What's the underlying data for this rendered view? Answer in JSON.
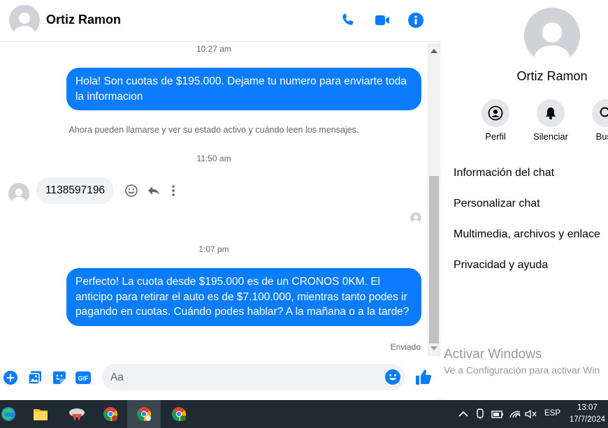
{
  "header": {
    "contact_name": "Ortiz Ramon"
  },
  "messages": {
    "ts1": "10:27 am",
    "out1": "Hola! Son cuotas de $195.000. Dejame tu numero para enviarte toda la informacion",
    "system_notice": "Ahora pueden llamarse y ver su estado activo y cuándo leen los mensajes.",
    "ts2": "11:50 am",
    "in1": "1138597196",
    "ts3": "1:07 pm",
    "out2": "Perfecto! La cuota desde $195.000 es de un CRONOS 0KM. El anticipo para retirar el auto es de $7.100.000, mientras tanto podes ir pagando en cuotas. Cuándo podes hablar? A la mañana o a la tarde?",
    "status": "Enviado"
  },
  "composer": {
    "placeholder": "Aa"
  },
  "sidebar": {
    "name": "Ortiz Ramon",
    "buttons": [
      {
        "label": "Perfil",
        "icon": "profile-icon"
      },
      {
        "label": "Silenciar",
        "icon": "bell-icon"
      },
      {
        "label": "Busc",
        "icon": "search-icon"
      }
    ],
    "rows": [
      "Información del chat",
      "Personalizar chat",
      "Multimedia, archivos y enlace",
      "Privacidad y ayuda"
    ]
  },
  "watermark": {
    "title": "Activar Windows",
    "subtitle": "Ve a Configuración para activar Win"
  },
  "taskbar": {
    "lang": "ESP",
    "time": "13:07",
    "date": "17/7/2024"
  },
  "colors": {
    "accent": "#0a7cff",
    "bubble_in": "#f0f2f5",
    "taskbar": "#1f2a33"
  }
}
